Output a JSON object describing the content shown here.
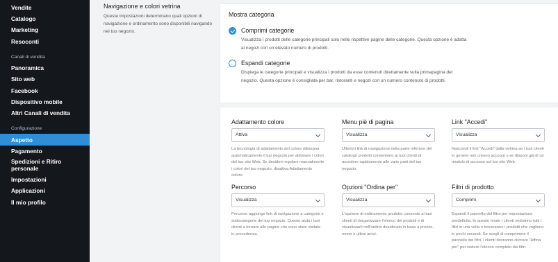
{
  "sidebar": {
    "top_items": [
      "Vendite",
      "Catalogo",
      "Marketing",
      "Resoconti"
    ],
    "channels_heading": "Canali di vendita",
    "channel_items": [
      "Panoramica",
      "Sito web",
      "Facebook",
      "Dispositivo mobile",
      "Altri Canali di vendita"
    ],
    "config_heading": "Configurazione",
    "config_items": [
      "Aspetto",
      "Pagamento",
      "Spedizioni e Ritiro personale",
      "Impostazioni",
      "Applicazioni",
      "Il mio profilo"
    ],
    "active_item": "Aspetto"
  },
  "section": {
    "title": "Navigazione e colori vetrina",
    "description": "Queste impostazioni determinano quali opzioni di navigazione e ordinamento sono disponibili navigando nel tuo negozio."
  },
  "category_card": {
    "title": "Mostra categoria",
    "options": [
      {
        "title": "Comprimi categorie",
        "description": "Visualizza i prodotti delle categorie principali solo nelle rispettive pagine delle categorie. Questa opzione è adatta ai negozi con un elevato numero di prodotti.",
        "checked": true
      },
      {
        "title": "Espandi categorie",
        "description": "Dispiega le categorie principali e visualizza i prodotti da esse contenuti direttamente sulla primapagina del negozio. Questa opzione è consigliata per bar, ristoranti e negozi con un numero contenuto di prodotti.",
        "checked": false
      }
    ]
  },
  "settings_fields": [
    {
      "label": "Adattamento colore",
      "value": "Attiva",
      "help": "La tecnologia di adattamento del colore ridisegna automaticamente il tuo negozio per abbinare i colori del tuo sito Web. Se desideri regolare manualmente i colori del tuo negozio, disattiva Adattamento colore."
    },
    {
      "label": "Menu piè di pagina",
      "value": "Visualizza",
      "help": "Ulteriori link di navigazione nella parte inferiore del catalogo prodotti consentono ai tuoi clienti di accedere rapidamente alle varie parti del tuo negozio."
    },
    {
      "label": "Link \"Accedi\"",
      "value": "Visualizza",
      "help": "Nascondi il link \"Accedi\" dalla vetrina se i tuoi clienti in genere non creano account o se disponi già di un modulo di accesso sul tuo sito Web."
    },
    {
      "label": "Percorso",
      "value": "Visualizza",
      "help": "Percorso aggiunge link di navigazione a categorie e sottocategorie del tuo negozio. Questo aiuta i tuoi clienti a tornare alle pagine che sono state visitate in precedenza."
    },
    {
      "label": "Opzioni \"Ordina per\"",
      "value": "Visualizza",
      "help": "L'opzione di ordinamento prodotto consente ai tuoi clienti di riorganizzare l'elenco dei prodotti e di visualizzarli nell'ordine desiderato in base a prezzo, nome o ultimi arrivi."
    },
    {
      "label": "Filtri di prodotto",
      "value": "Comprimi",
      "help": "Espandi il pannello del filtro per impostazione predefinita. In questo modo i clienti vedranno tutti i filtri in una volta e troveranno i prodotti che vogliono in pochi secondi. Se scegli di comprimere il pannello dei filtri, i clienti dovranno cliccare \"Affina per\" per vedere l'elenco completo dei filtri."
    }
  ],
  "colors": {
    "sidebar_bg": "#14171c",
    "active_bg": "#2f8ed6",
    "accent": "#2f8ed6"
  }
}
